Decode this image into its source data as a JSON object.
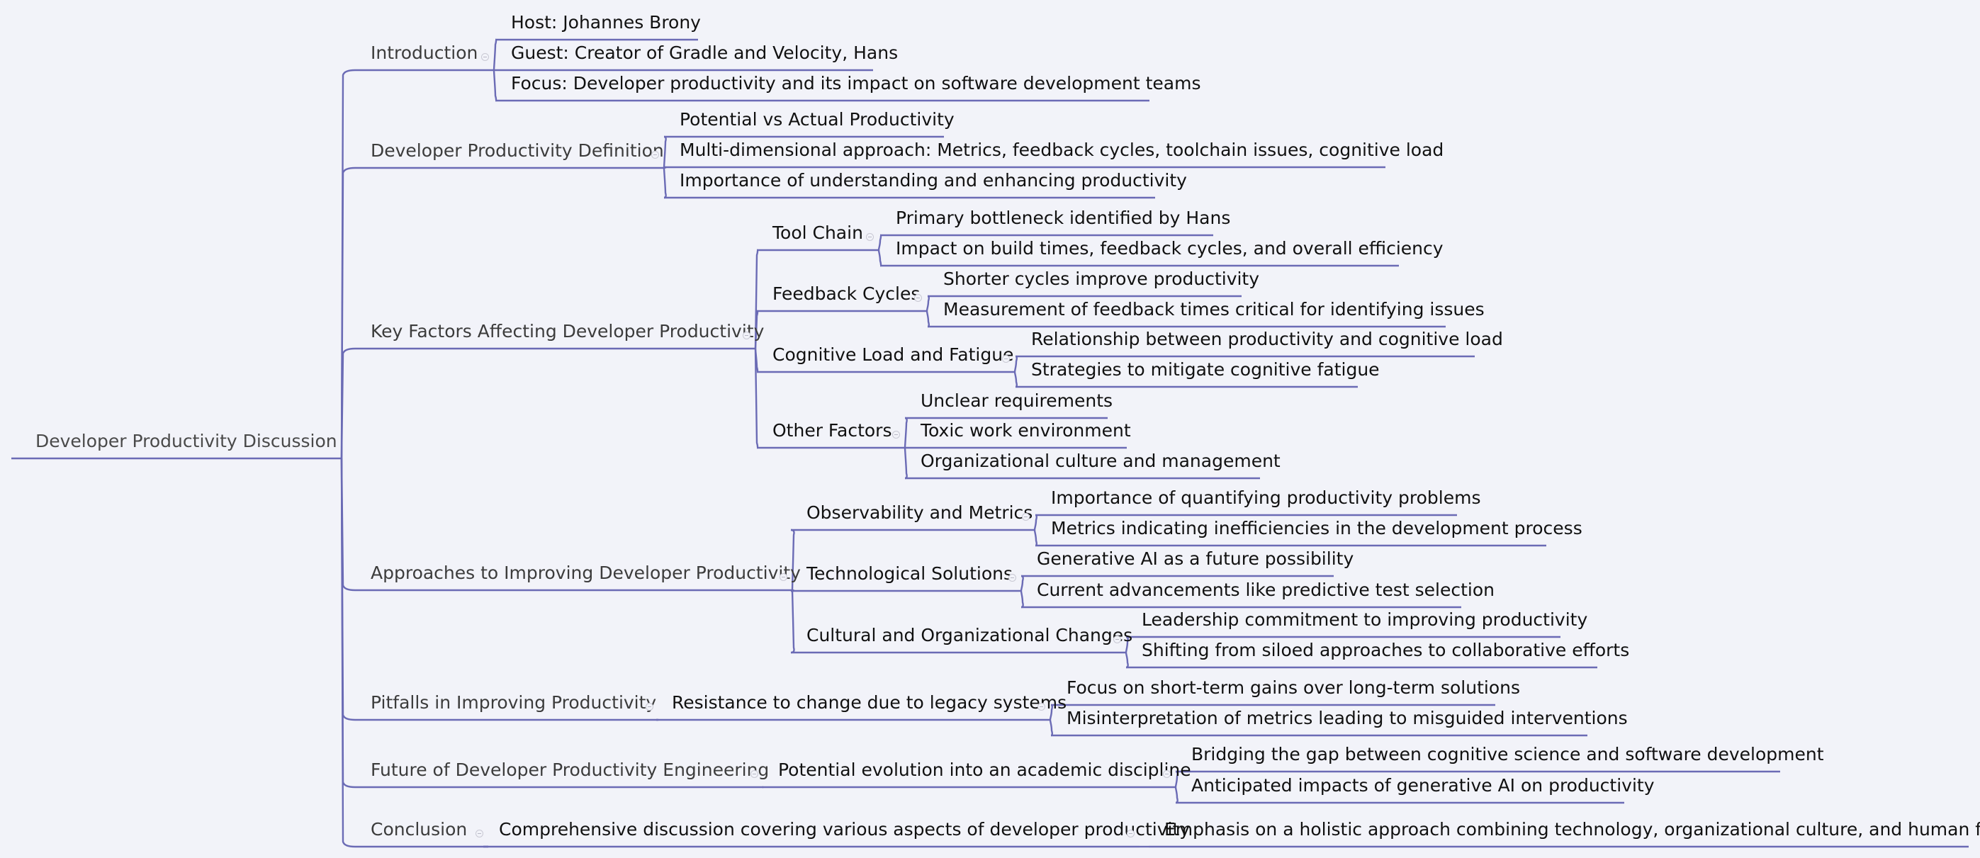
{
  "mindmap": {
    "root": {
      "label": "Developer Productivity Discussion",
      "children": [
        {
          "label": "Introduction",
          "children": [
            {
              "label": "Host: Johannes Brony"
            },
            {
              "label": "Guest: Creator of Gradle and Velocity, Hans"
            },
            {
              "label": "Focus: Developer productivity and its impact on software development teams"
            }
          ]
        },
        {
          "label": "Developer Productivity Definition",
          "children": [
            {
              "label": "Potential vs Actual Productivity"
            },
            {
              "label": "Multi-dimensional approach: Metrics, feedback cycles, toolchain issues, cognitive load"
            },
            {
              "label": "Importance of understanding and enhancing productivity"
            }
          ]
        },
        {
          "label": "Key Factors Affecting Developer Productivity",
          "children": [
            {
              "label": "Tool Chain",
              "children": [
                {
                  "label": "Primary bottleneck identified by Hans"
                },
                {
                  "label": "Impact on build times, feedback cycles, and overall efficiency"
                }
              ]
            },
            {
              "label": "Feedback Cycles",
              "children": [
                {
                  "label": "Shorter cycles improve productivity"
                },
                {
                  "label": "Measurement of feedback times critical for identifying issues"
                }
              ]
            },
            {
              "label": "Cognitive Load and Fatigue",
              "children": [
                {
                  "label": "Relationship between productivity and cognitive load"
                },
                {
                  "label": "Strategies to mitigate cognitive fatigue"
                }
              ]
            },
            {
              "label": "Other Factors",
              "children": [
                {
                  "label": "Unclear requirements"
                },
                {
                  "label": "Toxic work environment"
                },
                {
                  "label": "Organizational culture and management"
                }
              ]
            }
          ]
        },
        {
          "label": "Approaches to Improving Developer Productivity",
          "children": [
            {
              "label": "Observability and Metrics",
              "children": [
                {
                  "label": "Importance of quantifying productivity problems"
                },
                {
                  "label": "Metrics indicating inefficiencies in the development process"
                }
              ]
            },
            {
              "label": "Technological Solutions",
              "children": [
                {
                  "label": "Generative AI as a future possibility"
                },
                {
                  "label": "Current advancements like predictive test selection"
                }
              ]
            },
            {
              "label": "Cultural and Organizational Changes",
              "children": [
                {
                  "label": "Leadership commitment to improving productivity"
                },
                {
                  "label": "Shifting from siloed approaches to collaborative efforts"
                }
              ]
            }
          ]
        },
        {
          "label": "Pitfalls in Improving Productivity",
          "children": [
            {
              "label": "Resistance to change due to legacy systems",
              "children": [
                {
                  "label": "Focus on short-term gains over long-term solutions"
                },
                {
                  "label": "Misinterpretation of metrics leading to misguided interventions"
                }
              ]
            }
          ]
        },
        {
          "label": "Future of Developer Productivity Engineering",
          "children": [
            {
              "label": "Potential evolution into an academic discipline",
              "children": [
                {
                  "label": "Bridging the gap between cognitive science and software development"
                },
                {
                  "label": "Anticipated impacts of generative AI on productivity"
                }
              ]
            }
          ]
        },
        {
          "label": "Conclusion",
          "children": [
            {
              "label": "Comprehensive discussion covering various aspects of developer productivity",
              "children": [
                {
                  "label": "Emphasis on a holistic approach combining technology, organizational culture, and human factors"
                }
              ]
            }
          ]
        }
      ]
    },
    "icons": {
      "collapse": "collapse-toggle-icon"
    },
    "colors": {
      "background": "#f2f3f9",
      "connector": "#6b6bb5",
      "root_text": "#4a4a4a",
      "topic_text": "#3c3c3c",
      "subtopic_text": "#111111"
    }
  }
}
